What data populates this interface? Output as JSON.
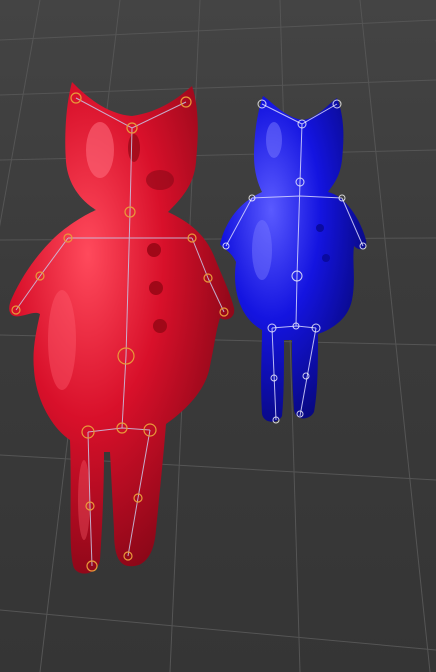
{
  "viewport": {
    "background_color": "#3d3d3d",
    "grid_color": "#555555"
  },
  "characters": [
    {
      "name": "red-character",
      "body_color": "#d8102a",
      "shade_color": "#8a0818",
      "highlight_color": "#ff7080",
      "selected": true,
      "bone_color": "#e89a3a"
    },
    {
      "name": "blue-character",
      "body_color": "#1414e0",
      "shade_color": "#080880",
      "highlight_color": "#8a8aff",
      "selected": false,
      "bone_color": "#d8d8ff"
    }
  ]
}
